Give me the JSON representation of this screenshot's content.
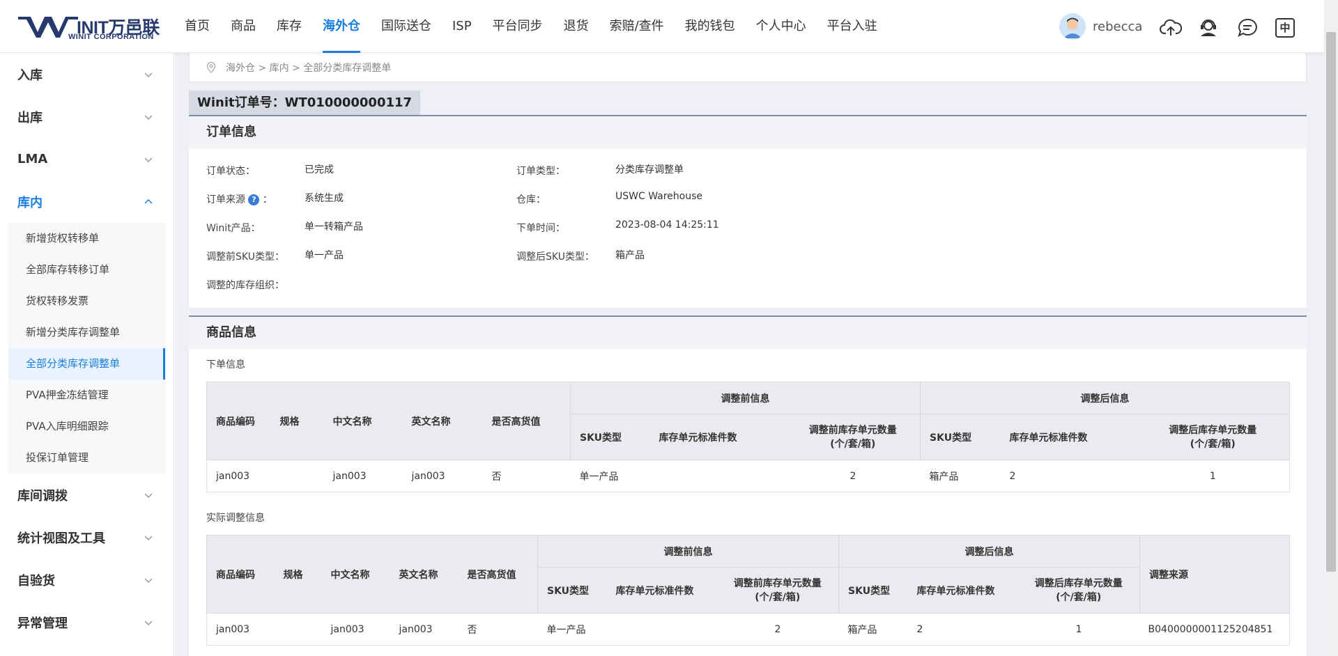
{
  "logo": {
    "main": "INIT万邑联",
    "sub": "WINIT CORPORATION"
  },
  "nav": [
    "首页",
    "商品",
    "库存",
    "海外仓",
    "国际送仓",
    "ISP",
    "平台同步",
    "退货",
    "索赔/查件",
    "我的钱包",
    "个人中心",
    "平台入驻"
  ],
  "nav_active_index": 3,
  "user": {
    "name": "rebecca",
    "lang_label": "中"
  },
  "sidebar": {
    "groups_top": [
      "入库",
      "出库",
      "LMA"
    ],
    "open_group": "库内",
    "items": [
      "新增货权转移单",
      "全部库存转移订单",
      "货权转移发票",
      "新增分类库存调整单",
      "全部分类库存调整单",
      "PVA押金冻结管理",
      "PVA入库明细跟踪",
      "投保订单管理"
    ],
    "active_item_index": 4,
    "groups_bottom": [
      "库间调拨",
      "统计视图及工具",
      "自验货",
      "异常管理"
    ]
  },
  "breadcrumb": "海外仓 > 库内 > 全部分类库存调整单",
  "order_tab": "Winit订单号：WT010000000117",
  "order_info": {
    "title": "订单信息",
    "status_label": "订单状态：",
    "status_value": "已完成",
    "type_label": "订单类型：",
    "type_value": "分类库存调整单",
    "source_label": "订单来源",
    "source_colon": "：",
    "source_value": "系统生成",
    "warehouse_label": "仓库：",
    "warehouse_value": "USWC Warehouse",
    "product_label": "Winit产品：",
    "product_value": "单一转箱产品",
    "time_label": "下单时间：",
    "time_value": "2023-08-04 14:25:11",
    "before_sku_label": "调整前SKU类型：",
    "before_sku_value": "单一产品",
    "after_sku_label": "调整后SKU类型：",
    "after_sku_value": "箱产品",
    "org_label": "调整的库存组织："
  },
  "goods_info": {
    "title": "商品信息",
    "order_section": "下单信息",
    "actual_section": "实际调整信息",
    "headers": {
      "code": "商品编码",
      "spec": "规格",
      "cn_name": "中文名称",
      "en_name": "英文名称",
      "high_value": "是否高货值",
      "before_group": "调整前信息",
      "after_group": "调整后信息",
      "sku_type": "SKU类型",
      "std_count": "库存单元标准件数",
      "before_qty_1": "调整前库存单元数量",
      "after_qty_1": "调整后库存单元数量",
      "qty_unit": "(个/套/箱)",
      "source": "调整来源"
    },
    "order_row": {
      "code": "jan003",
      "spec": "",
      "cn": "jan003",
      "en": "jan003",
      "hv": "否",
      "b_sku": "单一产品",
      "b_std": "",
      "b_qty": "2",
      "a_sku": "箱产品",
      "a_std": "2",
      "a_qty": "1"
    },
    "actual_row": {
      "code": "jan003",
      "spec": "",
      "cn": "jan003",
      "en": "jan003",
      "hv": "否",
      "b_sku": "单一产品",
      "b_std": "",
      "b_qty": "2",
      "a_sku": "箱产品",
      "a_std": "2",
      "a_qty": "1",
      "source": "B0400000001125204851"
    }
  },
  "colors": {
    "accent": "#1a7ee0",
    "logo": "#263a6e",
    "header_bg": "#e9ebef",
    "tab_bg": "#d5d9e3"
  }
}
